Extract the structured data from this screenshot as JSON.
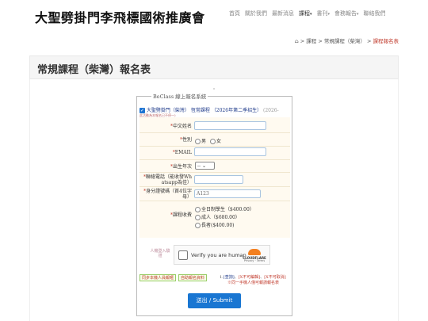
{
  "header": {
    "logo_text": "大聖劈掛門李飛標國術推廣會",
    "nav": [
      {
        "label": "首頁",
        "active": false,
        "has_caret": false
      },
      {
        "label": "關於我們",
        "active": false,
        "has_caret": false
      },
      {
        "label": "最新消息",
        "active": false,
        "has_caret": false
      },
      {
        "label": "課程",
        "active": true,
        "has_caret": true
      },
      {
        "label": "書刊",
        "active": false,
        "has_caret": true
      },
      {
        "label": "會務報告",
        "active": false,
        "has_caret": true
      },
      {
        "label": "聯絡我們",
        "active": false,
        "has_caret": false
      }
    ]
  },
  "breadcrumb": {
    "sep": ">",
    "items": [
      "課程",
      "常規課程（柴灣）"
    ],
    "current": "課程報名表"
  },
  "page_title": "常規課程（柴灣）報名表",
  "form": {
    "legend": "BeClass 線上報名系統",
    "course": {
      "org": "大聖劈掛門（柴灣）",
      "name": "恆常課程",
      "term": "（2026年第二季招生）",
      "tag": "(2026-",
      "subnote": "此活動為本報名已不停一)"
    },
    "fields": {
      "chinese_name": {
        "label": "中文姓名",
        "required": true,
        "value": ""
      },
      "gender": {
        "label": "性別",
        "required": true,
        "options": [
          "男",
          "女"
        ]
      },
      "email": {
        "label": "EMAIL",
        "required": true,
        "value": ""
      },
      "birth_year": {
        "label": "出生年次",
        "required": true,
        "value": "--"
      },
      "phone": {
        "label": "聯絡電話（能收發Wh atsapp為佳）",
        "required": true,
        "value": ""
      },
      "id_number": {
        "label": "身分證號碼（首4位字母）",
        "required": true,
        "placeholder": "A123"
      },
      "fee": {
        "label": "課程收費",
        "required": true,
        "options": [
          "全日制學生（$400.00）",
          "成人（$680.00）",
          "長者($400.00)"
        ]
      }
    },
    "human_label": "人機登入驗證",
    "captcha": {
      "text": "Verify you are human",
      "brand": "CLOUDFLARE",
      "links": "Privacy · Terms"
    },
    "helper_buttons": [
      "同步本機人員報暱",
      "自助報名資料"
    ],
    "links": {
      "prefix": "1.",
      "check": "[查詢]",
      "sep1": "、",
      "cancel": "[X不可編輯]",
      "sep2": "、",
      "cancel2": "[X不可取消]",
      "note": "※同一手機人僅可報請報名表"
    },
    "submit_label": "送出 / Submit"
  },
  "colors": {
    "accent": "#1976d2",
    "required": "#c0392b",
    "form_bg": "#fffaf0"
  }
}
